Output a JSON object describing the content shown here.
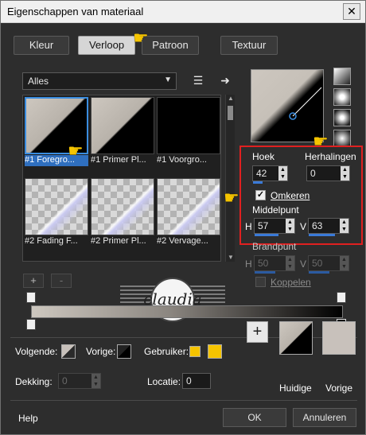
{
  "window": {
    "title": "Eigenschappen van materiaal",
    "close_label": "✕"
  },
  "tabs": [
    {
      "label": "Kleur",
      "active": false
    },
    {
      "label": "Verloop",
      "active": true
    },
    {
      "label": "Patroon",
      "active": false
    },
    {
      "label": "Textuur",
      "active": false
    }
  ],
  "category": {
    "selected": "Alles"
  },
  "gradients": [
    {
      "caption": "#1 Foregro...",
      "selected": true
    },
    {
      "caption": "#1 Primer Pl...",
      "selected": false
    },
    {
      "caption": "#1 Voorgro...",
      "selected": false
    },
    {
      "caption": "#2 Fading F...",
      "selected": false
    },
    {
      "caption": "#2 Primer Pl...",
      "selected": false
    },
    {
      "caption": "#2 Vervage...",
      "selected": false
    }
  ],
  "settings": {
    "hoek_label": "Hoek",
    "hoek_value": "42",
    "herhalingen_label": "Herhalingen",
    "herhalingen_value": "0",
    "omkeren_label": "Omkeren",
    "omkeren_checked": true,
    "middelpunt_label": "Middelpunt",
    "h_label": "H",
    "v_label": "V",
    "middelpunt_h": "57",
    "middelpunt_v": "63",
    "brandpunt_label": "Brandpunt",
    "brandpunt_h": "50",
    "brandpunt_v": "50",
    "koppelen_label": "Koppelen"
  },
  "editor": {
    "add_label": "+",
    "remove_label": "-"
  },
  "colors": {
    "volgende_label": "Volgende:",
    "vorige_label": "Vorige:",
    "gebruiker_label": "Gebruiker:",
    "user_color_1": "#f5c400",
    "user_color_2": "#f5c400",
    "huidige_label": "Huidige",
    "vorige_big_label": "Vorige",
    "vorige_swatch": "#c8c1bb"
  },
  "stops": {
    "dekking_label": "Dekking:",
    "dekking_value": "0",
    "locatie_label": "Locatie:",
    "locatie_value": "0"
  },
  "watermark": {
    "text": "claudia"
  },
  "footer": {
    "help": "Help",
    "ok": "OK",
    "cancel": "Annuleren"
  }
}
